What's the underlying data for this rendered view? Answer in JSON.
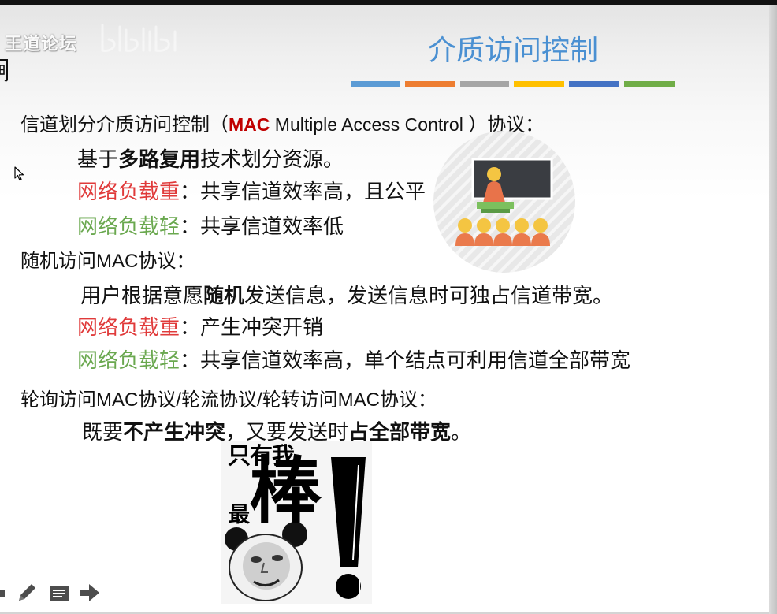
{
  "watermark": {
    "text": "王道论坛",
    "logo_icon": "bilibili-logo-icon"
  },
  "slide": {
    "title": "介质访问控制",
    "colors": {
      "title": "#4a90d2",
      "mac": "#c00000",
      "heavy_load": "#e03a3a",
      "light_load": "#6aa84f",
      "text": "#111111"
    },
    "accent_bar_colors": [
      "#5b9bd5",
      "#ed7d31",
      "#a5a5a5",
      "#ffc000",
      "#4472c4",
      "#70ad47"
    ],
    "channel_partition": {
      "heading": {
        "pre": "信道划分介质访问控制（",
        "mac": "MAC",
        "expansion": " Multiple Access Control ",
        "post": "）协议："
      },
      "basis": {
        "pre": "基于",
        "bold": "多路复用",
        "post": "技术划分资源。"
      },
      "heavy": {
        "label": "网络负载重",
        "text": "：共享信道效率高，且公平"
      },
      "light": {
        "label": "网络负载轻",
        "text": "：共享信道效率低"
      }
    },
    "random_access": {
      "heading": "随机访问MAC协议：",
      "desc": {
        "pre": "用户根据意愿",
        "bold": "随机",
        "post": "发送信息，发送信息时可独占信道带宽。"
      },
      "heavy": {
        "label": "网络负载重",
        "text": "：产生冲突开销"
      },
      "light": {
        "label": "网络负载轻",
        "text": "：共享信道效率高，单个结点可利用信道全部带宽"
      }
    },
    "polling": {
      "heading": "轮询访问MAC协议/轮流协议/轮转访问MAC协议：",
      "desc": {
        "pre": "既要",
        "bold1": "不产生冲突",
        "mid": "，又要发送时",
        "bold2": "占全部带宽",
        "post": "。"
      }
    }
  },
  "classroom_illustration": {
    "icon": "teacher-classroom-icon"
  },
  "meme": {
    "line1": "只有我",
    "small": "最",
    "big": "棒",
    "icon": "panda-face-icon"
  },
  "toolbar": {
    "icons": [
      "slide-menu-icon",
      "pen-icon",
      "notes-icon",
      "next-arrow-icon"
    ]
  },
  "cursor": {
    "icon": "mouse-pointer-icon"
  }
}
